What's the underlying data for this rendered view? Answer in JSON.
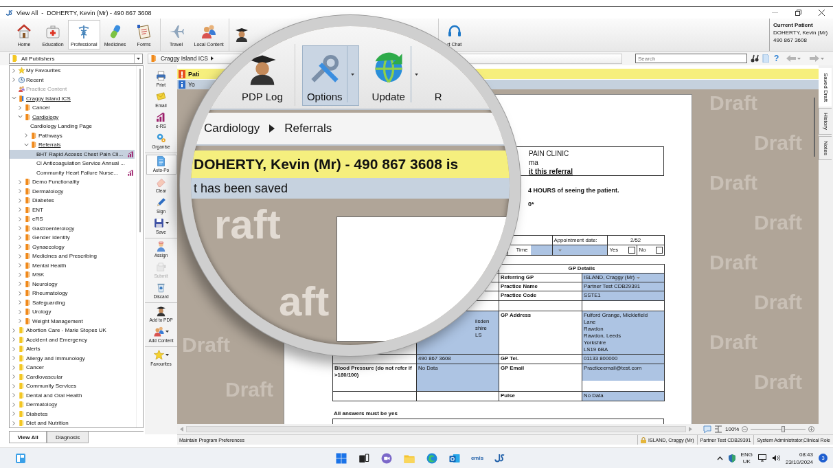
{
  "window": {
    "title": "View All  -  DOHERTY, Kevin (Mr) - 490 867 3608"
  },
  "ribbon": {
    "groups": [
      {
        "items": [
          {
            "label": "Home",
            "kind": "home",
            "selected": false
          },
          {
            "label": "Education",
            "kind": "education",
            "selected": false
          },
          {
            "label": "Professional",
            "kind": "professional",
            "selected": true
          },
          {
            "label": "Medicines",
            "kind": "medicines",
            "selected": false
          },
          {
            "label": "Forms",
            "kind": "forms",
            "selected": false
          }
        ]
      },
      {
        "items": [
          {
            "label": "Travel",
            "kind": "travel",
            "selected": false
          },
          {
            "label": "Local Content",
            "kind": "people",
            "selected": false
          }
        ]
      },
      {
        "items": [
          {
            "kind": "graduate",
            "selected": false
          }
        ]
      },
      {
        "items": [
          {
            "label": "rt Chat",
            "kind": "headset",
            "selected": false
          }
        ]
      }
    ]
  },
  "current_patient": {
    "heading": "Current Patient",
    "name": "DOHERTY, Kevin (Mr)",
    "number": "490 867 3608"
  },
  "address_bar": {
    "publisher": "All Publishers",
    "breadcrumb": [
      "Craggy Island ICS"
    ],
    "search_placeholder": "Search",
    "help": "?"
  },
  "tree": [
    {
      "label": "My Favourites",
      "kind": "favourites",
      "expanded": false,
      "selected": false,
      "disabled": false
    },
    {
      "label": "Recent",
      "kind": "recent",
      "expanded": false,
      "selected": false,
      "disabled": false
    },
    {
      "label": "Practice Content",
      "kind": "practice",
      "selected": false,
      "disabled": true
    },
    {
      "label": "Craggy Island ICS",
      "kind": "ics",
      "expanded": true,
      "selected": false,
      "disabled": false,
      "children": [
        {
          "label": "Cancer",
          "kind": "section",
          "expanded": false,
          "selected": false,
          "disabled": false
        },
        {
          "label": "Cardiology",
          "kind": "section",
          "expanded": true,
          "selected": false,
          "disabled": false,
          "children": [
            {
              "label": "Cardiology Landing Page",
              "selected": false,
              "disabled": false
            },
            {
              "label": "Pathways",
              "kind": "section",
              "expanded": false,
              "selected": false,
              "disabled": false
            },
            {
              "label": "Referrals",
              "kind": "section",
              "expanded": true,
              "selected": false,
              "disabled": false,
              "children": [
                {
                  "label": "BHT Rapid Access Chest Pain Cli...",
                  "ers": true,
                  "selected": true,
                  "disabled": false
                },
                {
                  "label": "CI Anticoagulation Service Annual ...",
                  "ers": false,
                  "selected": false,
                  "disabled": false
                },
                {
                  "label": "Community Heart Failure Nurse...",
                  "ers": true,
                  "selected": false,
                  "disabled": false
                }
              ]
            }
          ]
        },
        {
          "label": "Demo Functionality",
          "kind": "section",
          "expanded": false,
          "selected": false,
          "disabled": false
        },
        {
          "label": "Dermatology",
          "kind": "section",
          "expanded": false,
          "selected": false,
          "disabled": false
        },
        {
          "label": "Diabetes",
          "kind": "section",
          "expanded": false,
          "selected": false,
          "disabled": false
        },
        {
          "label": "ENT",
          "kind": "section",
          "expanded": false,
          "selected": false,
          "disabled": false
        },
        {
          "label": "eRS",
          "kind": "section",
          "expanded": false,
          "selected": false,
          "disabled": false
        },
        {
          "label": "Gastroenterology",
          "kind": "section",
          "expanded": false,
          "selected": false,
          "disabled": false
        },
        {
          "label": "Gender Identity",
          "kind": "section",
          "expanded": false,
          "selected": false,
          "disabled": false
        },
        {
          "label": "Gynaecology",
          "kind": "section",
          "expanded": false,
          "selected": false,
          "disabled": false
        },
        {
          "label": "Medicines and Prescribing",
          "kind": "section",
          "expanded": false,
          "selected": false,
          "disabled": false
        },
        {
          "label": "Mental Health",
          "kind": "section",
          "expanded": false,
          "selected": false,
          "disabled": false
        },
        {
          "label": "MSK",
          "kind": "section",
          "expanded": false,
          "selected": false,
          "disabled": false
        },
        {
          "label": "Neurology",
          "kind": "section",
          "expanded": false,
          "selected": false,
          "disabled": false
        },
        {
          "label": "Rheumatology",
          "kind": "section",
          "expanded": false,
          "selected": false,
          "disabled": false
        },
        {
          "label": "Safeguarding",
          "kind": "section",
          "expanded": false,
          "selected": false,
          "disabled": false
        },
        {
          "label": "Urology",
          "kind": "section",
          "expanded": false,
          "selected": false,
          "disabled": false
        },
        {
          "label": "Weight Management",
          "kind": "section",
          "expanded": false,
          "selected": false,
          "disabled": false
        }
      ]
    },
    {
      "label": "Abortion Care - Marie Stopes UK",
      "kind": "publisher",
      "expanded": false,
      "selected": false,
      "disabled": false
    },
    {
      "label": "Accident and Emergency",
      "kind": "publisher",
      "expanded": false,
      "selected": false,
      "disabled": false
    },
    {
      "label": "Alerts",
      "kind": "publisher",
      "expanded": false,
      "selected": false,
      "disabled": false
    },
    {
      "label": "Allergy and Immunology",
      "kind": "publisher",
      "expanded": false,
      "selected": false,
      "disabled": false
    },
    {
      "label": "Cancer",
      "kind": "publisher",
      "expanded": false,
      "selected": false,
      "disabled": false
    },
    {
      "label": "Cardiovascular",
      "kind": "publisher",
      "expanded": false,
      "selected": false,
      "disabled": false
    },
    {
      "label": "Community Services",
      "kind": "publisher",
      "expanded": false,
      "selected": false,
      "disabled": false
    },
    {
      "label": "Dental and Oral Health",
      "kind": "publisher",
      "expanded": false,
      "selected": false,
      "disabled": false
    },
    {
      "label": "Dermatology",
      "kind": "publisher",
      "expanded": false,
      "selected": false,
      "disabled": false
    },
    {
      "label": "Diabetes",
      "kind": "publisher",
      "expanded": false,
      "selected": false,
      "disabled": false
    },
    {
      "label": "Diet and Nutrition",
      "kind": "publisher",
      "expanded": false,
      "selected": false,
      "disabled": false
    }
  ],
  "sidebar_tabs": [
    {
      "label": "View All",
      "selected": true
    },
    {
      "label": "Diagnosis",
      "selected": false
    }
  ],
  "tools": {
    "groups": [
      {
        "items": [
          {
            "label": "Print",
            "kind": "print",
            "dropdown": false,
            "on": false,
            "disabled": false
          },
          {
            "label": "Email",
            "kind": "email",
            "dropdown": false,
            "on": false,
            "disabled": false
          },
          {
            "label": "e-RS",
            "kind": "ers",
            "dropdown": false,
            "on": false,
            "disabled": false
          },
          {
            "label": "Organise",
            "kind": "organise",
            "dropdown": false,
            "on": false,
            "disabled": false
          }
        ]
      },
      {
        "items": [
          {
            "label": "Auto-Po",
            "kind": "autopop",
            "dropdown": false,
            "on": true,
            "disabled": false
          },
          {
            "label": "Clear",
            "kind": "clear",
            "dropdown": false,
            "on": false,
            "disabled": false
          },
          {
            "label": "Sign",
            "kind": "sign",
            "dropdown": false,
            "on": false,
            "disabled": false
          },
          {
            "label": "Save",
            "kind": "save",
            "dropdown": true,
            "on": false,
            "disabled": false
          }
        ]
      },
      {
        "items": [
          {
            "label": "Assign",
            "kind": "assign",
            "dropdown": false,
            "on": false,
            "disabled": false
          },
          {
            "label": "Submit",
            "kind": "submit",
            "dropdown": false,
            "on": false,
            "disabled": true
          },
          {
            "label": "Discard",
            "kind": "discard",
            "dropdown": false,
            "on": false,
            "disabled": false
          }
        ]
      },
      {
        "items": [
          {
            "label": "Add to PDP",
            "kind": "graduate",
            "dropdown": false,
            "on": false,
            "disabled": false
          },
          {
            "label": "Add Content",
            "kind": "people",
            "dropdown": true,
            "on": false,
            "disabled": false
          }
        ]
      },
      {
        "items": [
          {
            "label": "Favourites",
            "kind": "favourites",
            "dropdown": true,
            "on": false,
            "disabled": false
          }
        ]
      }
    ]
  },
  "notice_bar": {
    "text": "Pati"
  },
  "info_bar": {
    "text": "Yo"
  },
  "document": {
    "header_lines": [
      {
        "kind": "title",
        "text": "PAIN CLINIC"
      },
      {
        "kind": "text",
        "text": "ma"
      },
      {
        "kind": "link",
        "text": "it this referral"
      }
    ],
    "instruction": "4 HOURS of seeing the patient.",
    "note": "0*",
    "appointment": {
      "date_label": "Appointment date:",
      "date_value": "2/52",
      "time_label": "Time",
      "options": [
        {
          "label": "Yes",
          "checked": false
        },
        {
          "label": "No",
          "checked": false
        }
      ]
    },
    "gp_table": {
      "heading": "GP Details",
      "rows": [
        [
          {
            "kind": "blank"
          },
          {
            "kind": "blank"
          },
          {
            "kind": "label",
            "text": "Referring GP"
          },
          {
            "kind": "field",
            "text": "ISLAND, Craggy (Mr)",
            "dropdown": true
          }
        ],
        [
          {
            "kind": "blank"
          },
          {
            "kind": "blank"
          },
          {
            "kind": "label",
            "text": "Practice Name"
          },
          {
            "kind": "field",
            "text": "Partner Test CDB29391"
          }
        ],
        [
          {
            "kind": "blank"
          },
          {
            "kind": "blank"
          },
          {
            "kind": "label",
            "text": "Practice Code"
          },
          {
            "kind": "field",
            "text": "SSTE1"
          }
        ],
        [
          {
            "kind": "blank"
          },
          {
            "kind": "blank"
          },
          {
            "kind": "blank"
          },
          {
            "kind": "blank"
          }
        ],
        [
          {
            "kind": "blank"
          },
          {
            "kind": "field",
            "lines": [
              "ilsden",
              "shire",
              "LS"
            ]
          },
          {
            "kind": "label",
            "text": "GP Address"
          },
          {
            "kind": "field",
            "lines": [
              "Fulford Grange, Micklefield",
              "Lane",
              "Rawdon",
              "Rawdon, Leeds",
              "Yorkshire",
              "LS19 6BA"
            ]
          }
        ],
        [
          {
            "kind": "blank"
          },
          {
            "kind": "field",
            "text": "490 867 3608"
          },
          {
            "kind": "label",
            "text": "GP Tel."
          },
          {
            "kind": "field",
            "text": "01133 800000"
          }
        ],
        [
          {
            "kind": "label",
            "text": "Blood Pressure (do not refer if >180/100)"
          },
          {
            "kind": "field",
            "text": "No Data"
          },
          {
            "kind": "label",
            "text": "GP Email"
          },
          {
            "kind": "short_field",
            "text": "Practiceemail@test.com"
          }
        ],
        [
          {
            "kind": "blank"
          },
          {
            "kind": "blank"
          },
          {
            "kind": "label",
            "text": "Pulse"
          },
          {
            "kind": "field",
            "text": "No Data"
          }
        ]
      ]
    },
    "footer": "All answers must be yes"
  },
  "watermarks": {
    "left": [
      "Draft",
      "Draft"
    ],
    "right": [
      "Draft",
      "Draft",
      "Draft",
      "Draft",
      "Draft",
      "Draft",
      "Draft",
      "Draft"
    ]
  },
  "zoom": {
    "reading": "100%",
    "level": 0.58
  },
  "side_tabs": [
    {
      "label": "Saved Draft",
      "selected": true
    },
    {
      "label": "History",
      "selected": false
    },
    {
      "label": "Notes",
      "selected": false
    }
  ],
  "status_bar": {
    "message": "Maintain Program Preferences",
    "user": "ISLAND, Craggy (Mr)",
    "practice": "Partner Test CDB29391",
    "role": "System Administrator,Clinical Role"
  },
  "magnifier": {
    "toolbar": [
      {
        "label": "PDP Log",
        "kind": "graduate",
        "selected": false,
        "dropdown": false
      },
      {
        "label": "Options",
        "kind": "options",
        "selected": true,
        "dropdown": true
      },
      {
        "label": "Update",
        "kind": "update",
        "selected": false,
        "dropdown": true
      },
      {
        "label": "R",
        "kind": "text",
        "selected": false,
        "dropdown": false
      }
    ],
    "breadcrumb": [
      "Cardiology",
      "Referrals"
    ],
    "banner": "DOHERTY, Kevin (Mr) - 490 867 3608 is",
    "message": "t has been saved",
    "watermarks": [
      "raft",
      "aft"
    ]
  },
  "taskbar": {
    "apps": [
      {
        "kind": "start"
      },
      {
        "kind": "taskview"
      },
      {
        "kind": "chat"
      },
      {
        "kind": "explorer"
      },
      {
        "kind": "edge"
      },
      {
        "kind": "outlook"
      },
      {
        "kind": "emis",
        "label": "emis"
      },
      {
        "kind": "app"
      }
    ],
    "tray": {
      "language": "ENG",
      "region": "UK",
      "time": "08:43",
      "date": "23/10/2024",
      "notifications": "3"
    }
  }
}
